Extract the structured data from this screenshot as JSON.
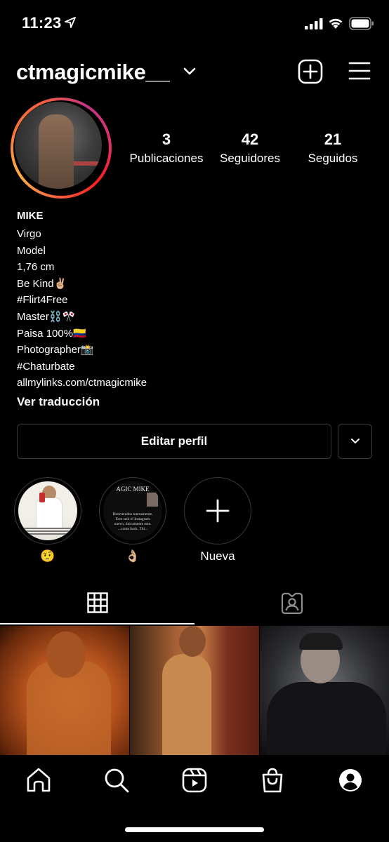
{
  "status_bar": {
    "time": "11:23"
  },
  "header": {
    "username": "ctmagicmike__"
  },
  "stats": [
    {
      "count": "3",
      "label": "Publicaciones"
    },
    {
      "count": "42",
      "label": "Seguidores"
    },
    {
      "count": "21",
      "label": "Seguidos"
    }
  ],
  "bio": {
    "name": "MIKE ",
    "lines": [
      "Virgo",
      "Model",
      "1,76 cm",
      "Be Kind✌🏼",
      "#Flirt4Free",
      "Master⛓️🎌",
      "Paisa 100%🇨🇴",
      "Photographer📸",
      "#Chaturbate"
    ],
    "link": "allmylinks.com/ctmagicmike",
    "translate": "Ver traducción"
  },
  "buttons": {
    "edit_profile": "Editar perfil"
  },
  "highlights": [
    {
      "label": "🤨"
    },
    {
      "label": "👌🏼",
      "cover_title": "AGIC MIKE",
      "cover_text": "Bienvenidos nuevamente. Este será el Instagram nuevo, únicamente este. ...come back. Thi..."
    },
    {
      "label": "Nueva"
    }
  ],
  "tabs": {
    "active": "grid"
  },
  "icons": {
    "location": "location-arrow-icon",
    "signal": "signal-icon",
    "wifi": "wifi-icon",
    "battery": "battery-icon",
    "chevron": "chevron-down-icon",
    "new_post": "plus-square-icon",
    "menu": "hamburger-menu-icon",
    "grid": "grid-icon",
    "tagged": "tagged-person-icon",
    "home": "home-icon",
    "search": "search-icon",
    "reels": "reels-icon",
    "shop": "shopping-bag-icon",
    "profile": "profile-icon"
  },
  "colors": {
    "background": "#000000",
    "text": "#ffffff",
    "border": "#3a3a3a"
  }
}
